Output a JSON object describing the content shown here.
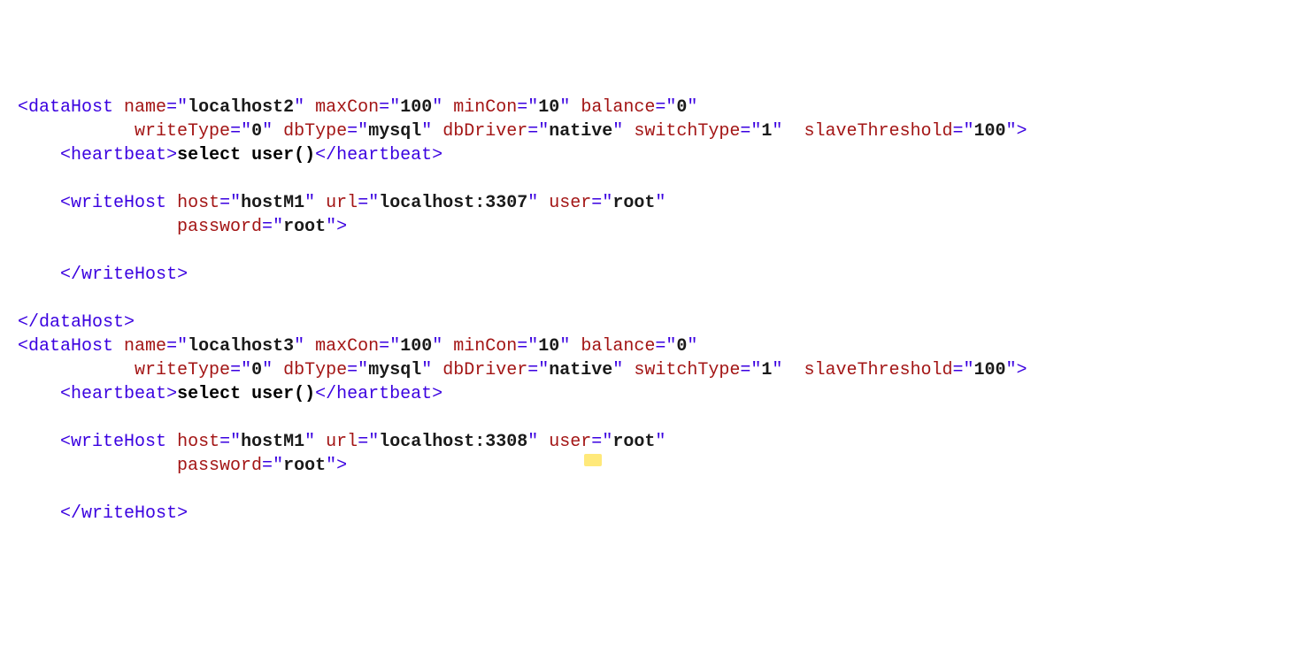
{
  "dh1": {
    "tag": "dataHost",
    "name_attr": "name",
    "name_val": "localhost2",
    "maxCon_attr": "maxCon",
    "maxCon_val": "100",
    "minCon_attr": "minCon",
    "minCon_val": "10",
    "balance_attr": "balance",
    "balance_val": "0",
    "writeType_attr": "writeType",
    "writeType_val": "0",
    "dbType_attr": "dbType",
    "dbType_val": "mysql",
    "dbDriver_attr": "dbDriver",
    "dbDriver_val": "native",
    "switchType_attr": "switchType",
    "switchType_val": "1",
    "slaveThreshold_attr": "slaveThreshold",
    "slaveThreshold_val": "100",
    "heartbeat_tag": "heartbeat",
    "heartbeat_text": "select user()",
    "wh": {
      "tag": "writeHost",
      "host_attr": "host",
      "host_val": "hostM1",
      "url_attr": "url",
      "url_val": "localhost:3307",
      "user_attr": "user",
      "user_val": "root",
      "password_attr": "password",
      "password_val": "root"
    }
  },
  "dh2": {
    "tag": "dataHost",
    "name_attr": "name",
    "name_val": "localhost3",
    "maxCon_attr": "maxCon",
    "maxCon_val": "100",
    "minCon_attr": "minCon",
    "minCon_val": "10",
    "balance_attr": "balance",
    "balance_val": "0",
    "writeType_attr": "writeType",
    "writeType_val": "0",
    "dbType_attr": "dbType",
    "dbType_val": "mysql",
    "dbDriver_attr": "dbDriver",
    "dbDriver_val": "native",
    "switchType_attr": "switchType",
    "switchType_val": "1",
    "slaveThreshold_attr": "slaveThreshold",
    "slaveThreshold_val": "100",
    "heartbeat_tag": "heartbeat",
    "heartbeat_text": "select user()",
    "wh": {
      "tag": "writeHost",
      "host_attr": "host",
      "host_val": "hostM1",
      "url_attr": "url",
      "url_val": "localhost:3308",
      "user_attr": "user",
      "user_val": "root",
      "password_attr": "password",
      "password_val": "root"
    }
  },
  "sym": {
    "lt": "<",
    "gt": ">",
    "slash": "/",
    "eq": "=",
    "q": "\""
  }
}
